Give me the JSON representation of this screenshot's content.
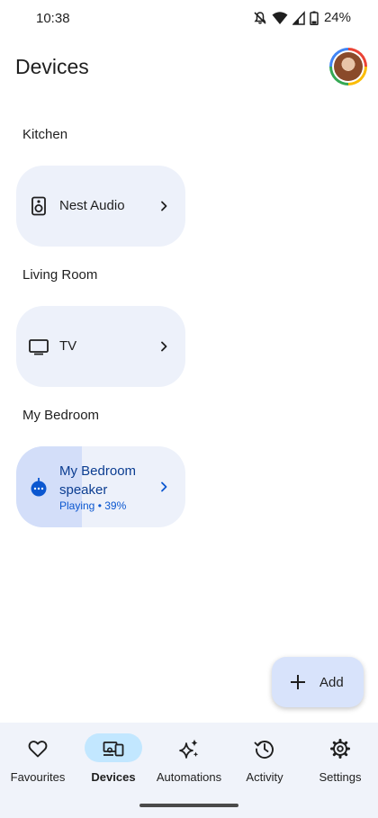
{
  "status_bar": {
    "time": "10:38",
    "battery": "24%",
    "icons": [
      "mute-icon",
      "wifi-icon",
      "signal-icon",
      "battery-icon"
    ]
  },
  "header": {
    "title": "Devices"
  },
  "rooms": [
    {
      "name": "Kitchen",
      "device": {
        "name": "Nest Audio",
        "icon": "speaker-icon"
      }
    },
    {
      "name": "Living Room",
      "device": {
        "name": "TV",
        "icon": "tv-icon"
      }
    },
    {
      "name": "My Bedroom",
      "device": {
        "name_line1": "My Bedroom",
        "name_line2": "speaker",
        "status": "Playing • 39%",
        "progress": 0.39,
        "icon": "smart-speaker-icon"
      }
    }
  ],
  "fab": {
    "label": "Add",
    "icon": "plus-icon"
  },
  "bottom_nav": {
    "active": "Devices",
    "items": [
      {
        "label": "Favourites",
        "icon": "heart-icon"
      },
      {
        "label": "Devices",
        "icon": "devices-icon"
      },
      {
        "label": "Automations",
        "icon": "sparkle-icon"
      },
      {
        "label": "Activity",
        "icon": "history-icon"
      },
      {
        "label": "Settings",
        "icon": "gear-icon"
      }
    ]
  },
  "colors": {
    "card_bg": "#edf1fa",
    "card_playing_fill": "#d3def9",
    "accent_blue": "#0b57d0",
    "nav_active_pill": "#c2e7ff",
    "nav_bg": "#f0f3fa",
    "fab_bg": "#d8e3fb"
  }
}
